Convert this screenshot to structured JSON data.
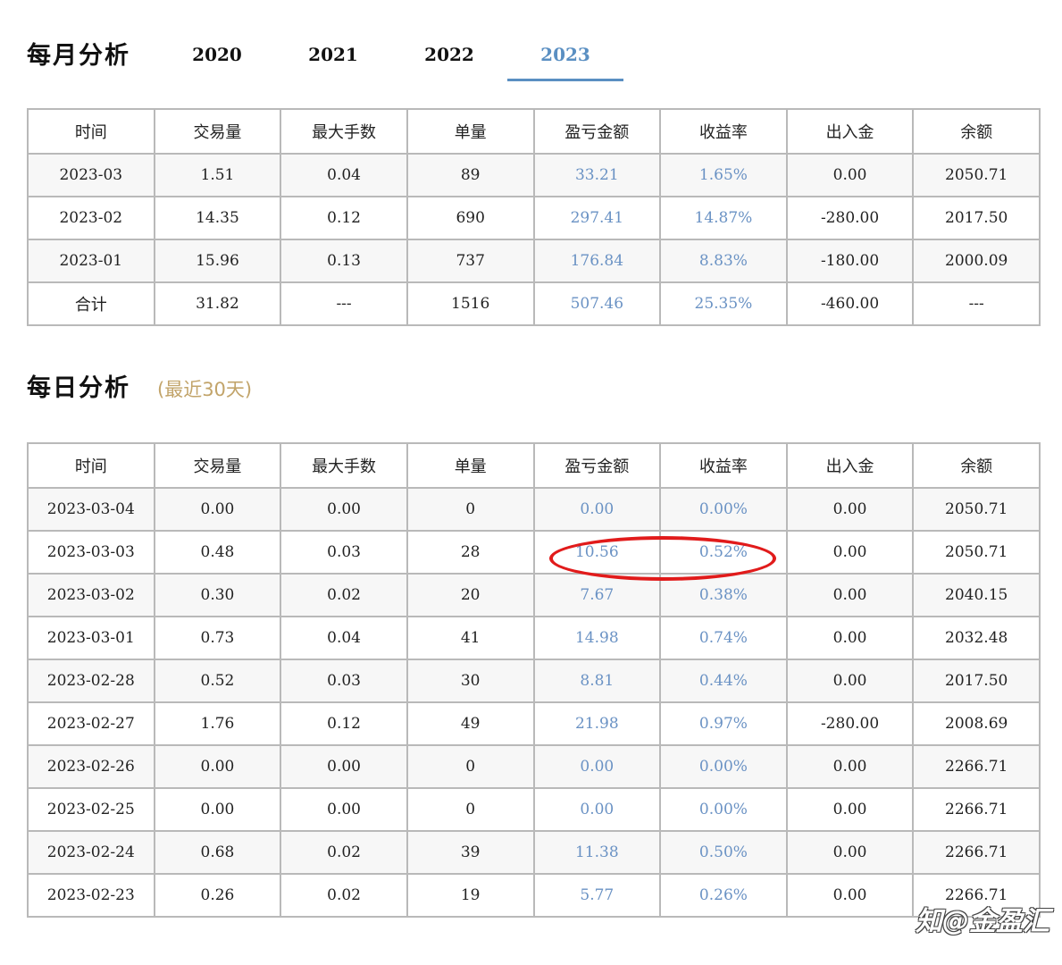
{
  "monthly": {
    "title": "每月分析",
    "tabs": [
      {
        "label": "2020",
        "active": false
      },
      {
        "label": "2021",
        "active": false
      },
      {
        "label": "2022",
        "active": false
      },
      {
        "label": "2023",
        "active": true
      }
    ],
    "headers": [
      "时间",
      "交易量",
      "最大手数",
      "单量",
      "盈亏金额",
      "收益率",
      "出入金",
      "余额"
    ],
    "rows": [
      [
        "2023-03",
        "1.51",
        "0.04",
        "89",
        "33.21",
        "1.65%",
        "0.00",
        "2050.71"
      ],
      [
        "2023-02",
        "14.35",
        "0.12",
        "690",
        "297.41",
        "14.87%",
        "-280.00",
        "2017.50"
      ],
      [
        "2023-01",
        "15.96",
        "0.13",
        "737",
        "176.84",
        "8.83%",
        "-180.00",
        "2000.09"
      ],
      [
        "合计",
        "31.82",
        "---",
        "1516",
        "507.46",
        "25.35%",
        "-460.00",
        "---"
      ]
    ]
  },
  "daily": {
    "title": "每日分析",
    "subtitle": "(最近30天)",
    "headers": [
      "时间",
      "交易量",
      "最大手数",
      "单量",
      "盈亏金额",
      "收益率",
      "出入金",
      "余额"
    ],
    "rows": [
      [
        "2023-03-04",
        "0.00",
        "0.00",
        "0",
        "0.00",
        "0.00%",
        "0.00",
        "2050.71"
      ],
      [
        "2023-03-03",
        "0.48",
        "0.03",
        "28",
        "10.56",
        "0.52%",
        "0.00",
        "2050.71"
      ],
      [
        "2023-03-02",
        "0.30",
        "0.02",
        "20",
        "7.67",
        "0.38%",
        "0.00",
        "2040.15"
      ],
      [
        "2023-03-01",
        "0.73",
        "0.04",
        "41",
        "14.98",
        "0.74%",
        "0.00",
        "2032.48"
      ],
      [
        "2023-02-28",
        "0.52",
        "0.03",
        "30",
        "8.81",
        "0.44%",
        "0.00",
        "2017.50"
      ],
      [
        "2023-02-27",
        "1.76",
        "0.12",
        "49",
        "21.98",
        "0.97%",
        "-280.00",
        "2008.69"
      ],
      [
        "2023-02-26",
        "0.00",
        "0.00",
        "0",
        "0.00",
        "0.00%",
        "0.00",
        "2266.71"
      ],
      [
        "2023-02-25",
        "0.00",
        "0.00",
        "0",
        "0.00",
        "0.00%",
        "0.00",
        "2266.71"
      ],
      [
        "2023-02-24",
        "0.68",
        "0.02",
        "39",
        "11.38",
        "0.50%",
        "0.00",
        "2266.71"
      ],
      [
        "2023-02-23",
        "0.26",
        "0.02",
        "19",
        "5.77",
        "0.26%",
        "0.00",
        "2266.71"
      ]
    ]
  },
  "watermark": "知@金盈汇",
  "colors": {
    "accent": "#5a8fc2",
    "value_blue": "#6a92c4",
    "highlight_red": "#e11b1b",
    "subtitle_gold": "#c2a46a"
  }
}
